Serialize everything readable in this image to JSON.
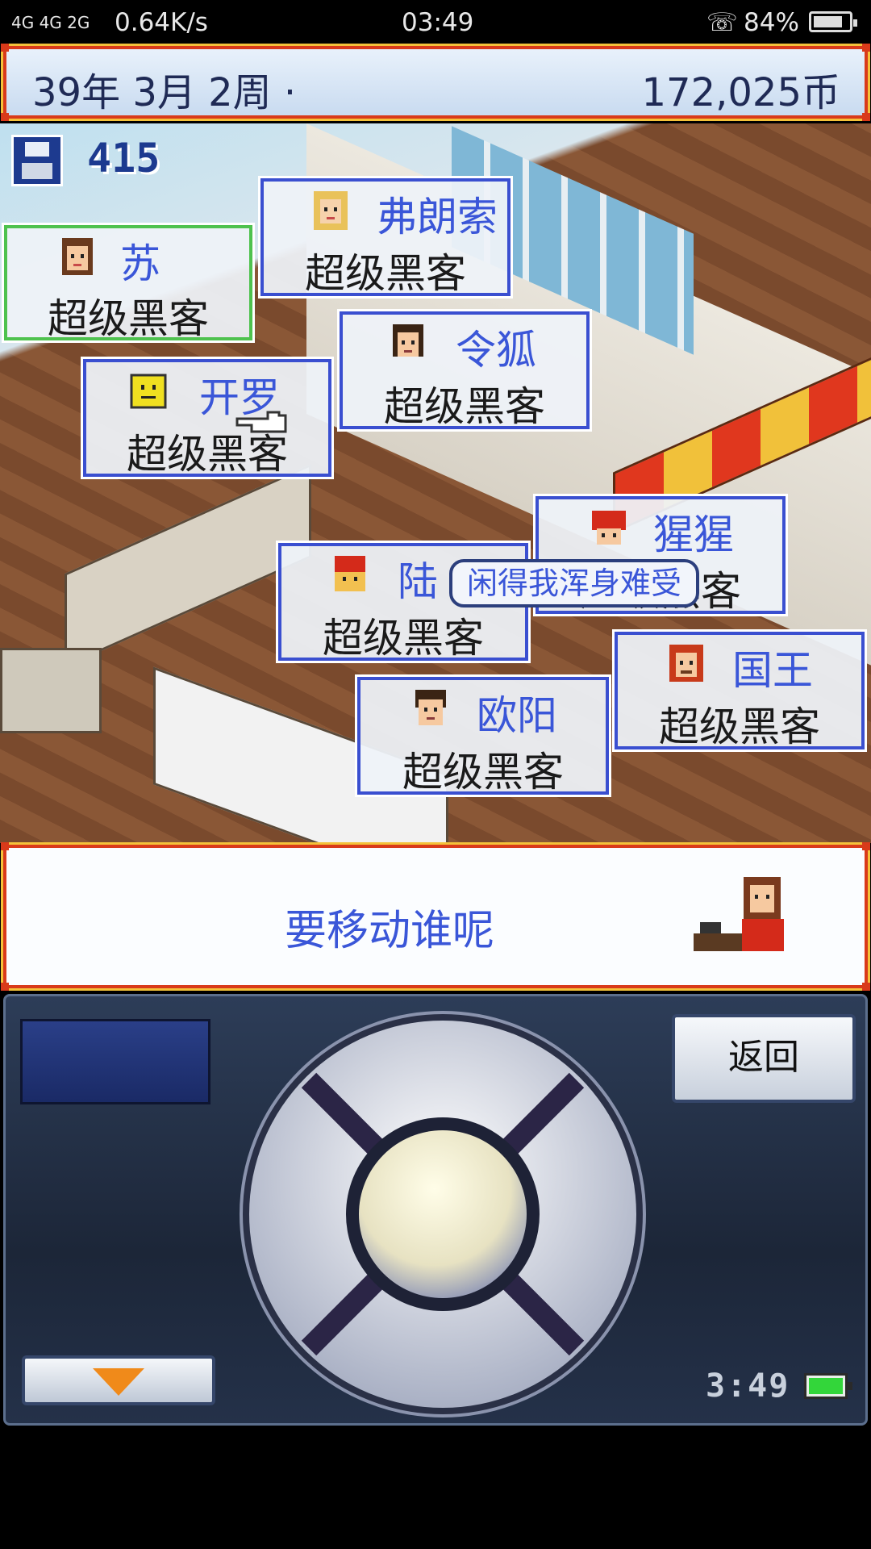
{
  "status_bar": {
    "network": "4G 4G  2G",
    "speed": "0.64K/s",
    "time": "03:49",
    "battery": "84%",
    "battery_level": 0.84
  },
  "top_bar": {
    "date": "39年 3月 2周 ·",
    "money": "172,025币"
  },
  "save_counter": "415",
  "speech_bubble": "闲得我浑身难受",
  "staff": [
    {
      "name": "苏",
      "role": "超级黑客",
      "selected": true,
      "face": "girl-face-icon"
    },
    {
      "name": "弗朗索",
      "role": "超级黑客",
      "selected": false,
      "face": "blonde-face-icon"
    },
    {
      "name": "令狐",
      "role": "超级黑客",
      "selected": false,
      "face": "boy-face-icon"
    },
    {
      "name": "开罗",
      "role": "超级黑客",
      "selected": false,
      "face": "yellow-tv-face-icon"
    },
    {
      "name": "猩猩",
      "role": "超级黑客",
      "selected": false,
      "face": "helmet-face-icon"
    },
    {
      "name": "陆",
      "role": "超级黑客",
      "selected": false,
      "face": "redhat-face-icon"
    },
    {
      "name": "国王",
      "role": "超级黑客",
      "selected": false,
      "face": "king-face-icon"
    },
    {
      "name": "欧阳",
      "role": "超级黑客",
      "selected": false,
      "face": "man-face-icon"
    }
  ],
  "message": "要移动谁呢",
  "controls": {
    "back_label": "返回",
    "clock": "3:49"
  },
  "colors": {
    "frame_red": "#d93a1a",
    "frame_gold": "#f4c23a",
    "name_blue": "#3a56d8",
    "card_border": "#3a4fd0",
    "selected_border": "#4ec24e"
  }
}
